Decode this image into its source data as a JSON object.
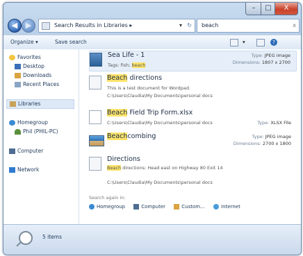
{
  "window": {
    "controls": {
      "minimize": "–",
      "maximize": "□",
      "close": "X"
    }
  },
  "nav": {
    "back": "◀",
    "forward": "▶",
    "address": "Search Results in Libraries ▸",
    "address_dropdown": "▾",
    "address_refresh": "↻",
    "search_value": "beach",
    "search_clear": "x"
  },
  "commands": {
    "organize": "Organize ▾",
    "save_search": "Save search",
    "view_dropdown": "▾",
    "help": "?"
  },
  "sidebar": {
    "favorites": "Favorites",
    "desktop": "Desktop",
    "downloads": "Downloads",
    "recent": "Recent Places",
    "libraries": "Libraries",
    "homegroup": "Homegroup",
    "homegroup_member": "Phil (PHIL-PC)",
    "computer": "Computer",
    "network": "Network"
  },
  "results": [
    {
      "name": "Sea Life - 1",
      "line2_prefix": "Tags: fish; ",
      "line2_hl": "beach",
      "meta1_k": "Type: ",
      "meta1_v": "JPEG image",
      "meta2_k": "Dimensions: ",
      "meta2_v": "1807 x 2700"
    },
    {
      "name_hl": "Beach",
      "name_rest": " directions",
      "line2": "This is a test document for Wordpad.",
      "line3": "C:\\Users\\Claudia\\My Documents\\personal docs"
    },
    {
      "name_hl": "Beach",
      "name_rest": " Field Trip Form.xlsx",
      "line2": "C:\\Users\\Claudia\\My Documents\\personal docs",
      "meta1_k": "Type: ",
      "meta1_v": "XLSX File"
    },
    {
      "name_hl": "Beach",
      "name_rest": "combing",
      "meta1_k": "Type: ",
      "meta1_v": "JPEG image",
      "meta2_k": "Dimensions: ",
      "meta2_v": "2700 x 1800"
    },
    {
      "name": "Directions",
      "line2_hl": "Beach",
      "line2_rest": " directions: Head east on Highway 80 Exit 14",
      "line3": "C:\\Users\\Claudia\\My Documents\\personal docs"
    }
  ],
  "search_again": {
    "label": "Search again in:",
    "homegroup": "Homegroup",
    "computer": "Computer",
    "custom": "Custom...",
    "internet": "Internet"
  },
  "status": {
    "count": "5 items"
  },
  "colors": {
    "highlight": "#fce36a",
    "close": "#c8412a"
  }
}
